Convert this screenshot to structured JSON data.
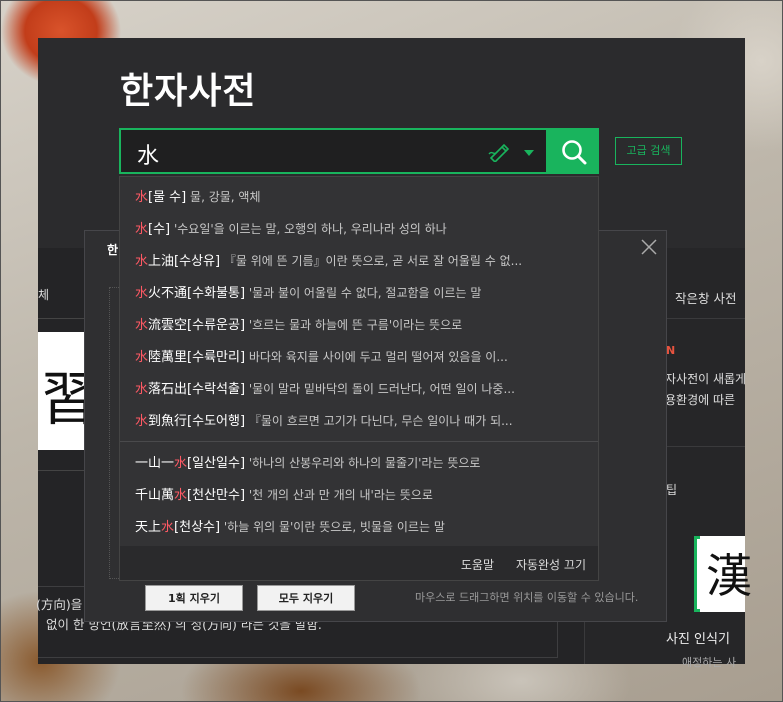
{
  "page": {
    "title": "한자사전",
    "search": {
      "value": "水",
      "button_label": "search",
      "advanced_label": "고급 검색"
    }
  },
  "background_panels": {
    "left_label": "체",
    "left_hanja": "習",
    "left_text1": "(方向)을",
    "left_text2": "없이 한 방언(放言至然) 의 정(方向) 라는 것을 말함.",
    "right_tab": "작은창 사전",
    "right_new": "N",
    "right_text1": "자사전이 새롭게",
    "right_text2": "용환경에 따른",
    "right_text3": "팁",
    "right_hanja": "漢",
    "right_text4": "사진 인식기",
    "right_text5": "애정하는 사"
  },
  "handwriting_popup": {
    "title": "한",
    "clear_one": "1획 지우기",
    "clear_all": "모두 지우기",
    "hint": "마우스로 드래그하면 위치를 이동할 수 있습니다."
  },
  "suggestions": [
    {
      "pre": "",
      "hl": "水",
      "post": "",
      "reading": "[물 수]",
      "def": " 물, 강물, 액체"
    },
    {
      "pre": "",
      "hl": "水",
      "post": "",
      "reading": "[수]",
      "def": " '수요일'을 이르는 말, 오행의 하나, 우리나라 성의 하나"
    },
    {
      "pre": "",
      "hl": "水",
      "post": "上油",
      "reading": "[수상유]",
      "def": " 『물 위에 뜬 기름』이란 뜻으로, 곧 서로 잘 어울릴 수 없..."
    },
    {
      "pre": "",
      "hl": "水",
      "post": "火不通",
      "reading": "[수화불통]",
      "def": " '물과 불이 어울릴 수 없다, 절교함을 이르는 말"
    },
    {
      "pre": "",
      "hl": "水",
      "post": "流雲空",
      "reading": "[수류운공]",
      "def": " '흐르는 물과 하늘에 뜬 구름'이라는 뜻으로"
    },
    {
      "pre": "",
      "hl": "水",
      "post": "陸萬里",
      "reading": "[수륙만리]",
      "def": " 바다와 육지를 사이에 두고 멀리 떨어져 있음을 이..."
    },
    {
      "pre": "",
      "hl": "水",
      "post": "落石出",
      "reading": "[수락석출]",
      "def": " '물이 말라 밑바닥의 돌이 드러난다, 어떤 일이 나중..."
    },
    {
      "pre": "",
      "hl": "水",
      "post": "到魚行",
      "reading": "[수도어행]",
      "def": " 『물이 흐르면 고기가 다닌다, 무슨 일이나 때가 되..."
    },
    {
      "pre": "一山一",
      "hl": "水",
      "post": "",
      "reading": "[일산일수]",
      "def": " '하나의 산봉우리와 하나의 물줄기'라는 뜻으로"
    },
    {
      "pre": "千山萬",
      "hl": "水",
      "post": "",
      "reading": "[천산만수]",
      "def": " '천 개의 산과 만 개의 내'라는 뜻으로"
    },
    {
      "pre": "天上",
      "hl": "水",
      "post": "",
      "reading": "[천상수]",
      "def": " '하늘 위의 물'이란 뜻으로, 빗물을 이르는 말"
    }
  ],
  "footer": {
    "help": "도움말",
    "autocomplete_off": "자동완성 끄기"
  },
  "colors": {
    "accent": "#19b45d",
    "highlight": "#ff5964",
    "panel": "#2b2b2d"
  }
}
